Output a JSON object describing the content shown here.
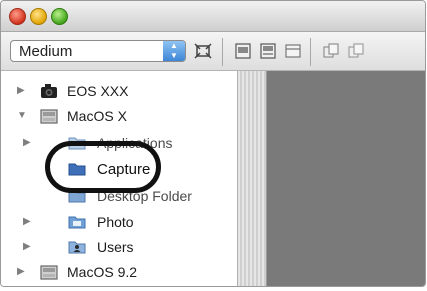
{
  "window": {
    "close_color": "#d2321d",
    "minimize_color": "#e2a400",
    "zoom_color": "#43a51c"
  },
  "toolbar": {
    "size_select_value": "Medium",
    "buttons": [
      "fit-screen-icon",
      "list-view-icon",
      "detail-view-icon",
      "panel-icon",
      "copy-icon",
      "copy-2-icon"
    ]
  },
  "tree": {
    "items": [
      {
        "label": "EOS XXX",
        "icon": "camera-icon",
        "expanded": false
      },
      {
        "label": "MacOS X",
        "icon": "drive-icon",
        "expanded": true
      },
      {
        "label": "Applications",
        "icon": "folder-icon",
        "expanded": false
      },
      {
        "label": "Capture",
        "icon": "folder-icon",
        "selected_highlight": true
      },
      {
        "label": "Desktop Folder",
        "icon": "folder-icon"
      },
      {
        "label": "Photo",
        "icon": "folder-icon",
        "expanded": false
      },
      {
        "label": "Users",
        "icon": "users-folder-icon",
        "expanded": false
      },
      {
        "label": "MacOS 9.2",
        "icon": "drive-icon",
        "expanded": false
      }
    ]
  },
  "colors": {
    "content_bg": "#7a7a7a",
    "highlight_ring": "#111111",
    "select_accent": "#3e86d6"
  }
}
